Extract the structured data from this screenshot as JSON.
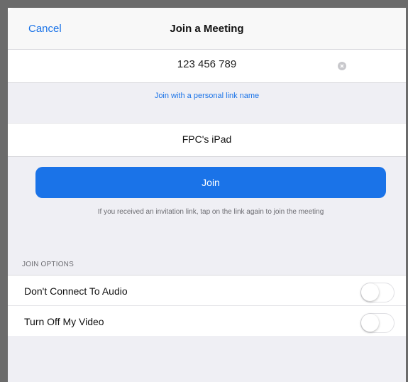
{
  "nav": {
    "cancel_label": "Cancel",
    "title": "Join a Meeting"
  },
  "meeting_id": {
    "value": "123 456 789",
    "clear_icon": "clear-circle-icon"
  },
  "personal_link": {
    "label": "Join with a personal link name"
  },
  "display_name": {
    "value": "FPC's iPad"
  },
  "join": {
    "label": "Join",
    "hint": "If you received an invitation link, tap on the link again to join the meeting"
  },
  "join_options": {
    "header": "JOIN OPTIONS",
    "items": [
      {
        "label": "Don't Connect To Audio",
        "enabled": false
      },
      {
        "label": "Turn Off My Video",
        "enabled": false
      }
    ]
  },
  "colors": {
    "accent": "#1a73e8",
    "background": "#efeff4",
    "frame": "#6b6b6b"
  }
}
